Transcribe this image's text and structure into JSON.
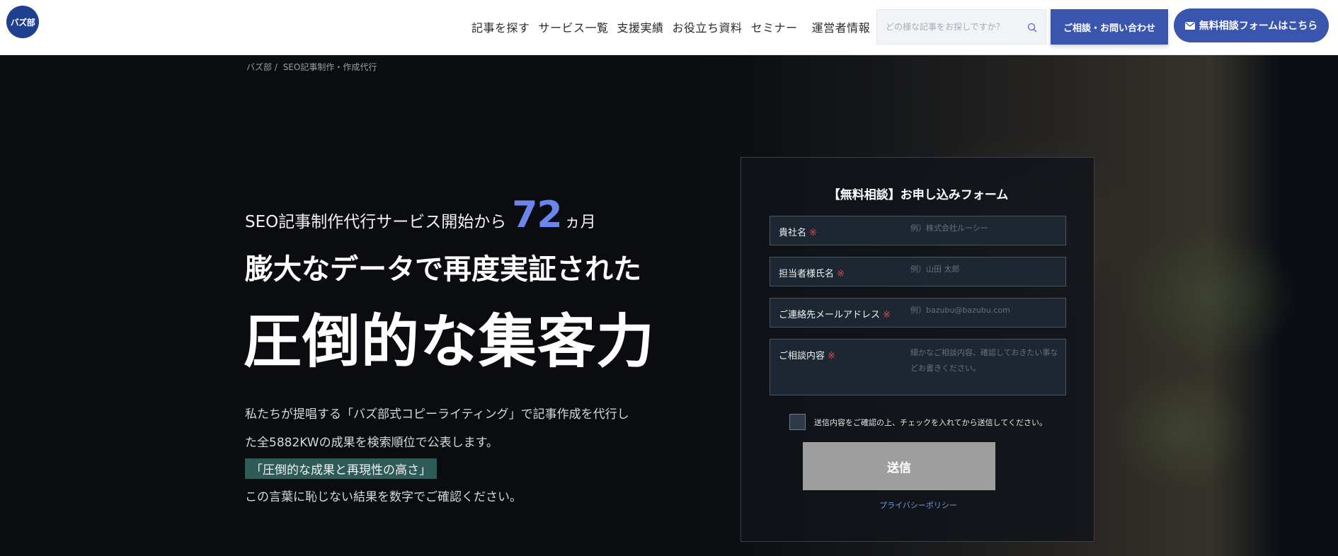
{
  "header": {
    "logo_text": "バズ部",
    "nav": [
      "記事を探す",
      "サービス一覧",
      "支援実績",
      "お役立ち資料",
      "セミナー",
      "運営者情報"
    ],
    "search_placeholder": "どの様な記事をお探しですか？",
    "contact_button": "ご相談・お問い合わせ",
    "form_button": "無料相談フォームはこちら",
    "accent_color": "#3a55ae"
  },
  "breadcrumb": [
    "バズ部 /",
    "SEO記事制作・作成代行"
  ],
  "hero": {
    "lead_prefix": "SEO記事制作代行サービス開始から",
    "months": "72",
    "months_unit": "ヵ月",
    "headline1": "膨大なデータで再度実証された",
    "headline2": "圧倒的な集客力",
    "desc_line1": "私たちが提唱する「バズ部式コピーライティング」で記事作成を代行し",
    "desc_line2": "た全5882KWの成果を検索順位で公表します。",
    "highlight": "「圧倒的な成果と再現性の高さ」",
    "closing": "この言葉に恥じない結果を数字でご確認ください。",
    "number_color": "#6c85ea"
  },
  "form": {
    "title": "【無料相談】お申し込みフォーム",
    "fields": [
      {
        "label": "貴社名",
        "required": "※",
        "placeholder": "例）株式会社ルーシー"
      },
      {
        "label": "担当者様氏名",
        "required": "※",
        "placeholder": "例）山田 太郎"
      },
      {
        "label": "ご連絡先メールアドレス",
        "required": "※",
        "placeholder": "例）bazubu@bazubu.com"
      },
      {
        "label": "ご相談内容",
        "required": "※",
        "placeholder": "細かなご相談内容、確認しておきたい事などお書きください。"
      }
    ],
    "checkbox_label": "送信内容をご確認の上、チェックを入れてから送信してください。",
    "submit_label": "送信",
    "privacy_link": "プライバシーポリシー"
  }
}
